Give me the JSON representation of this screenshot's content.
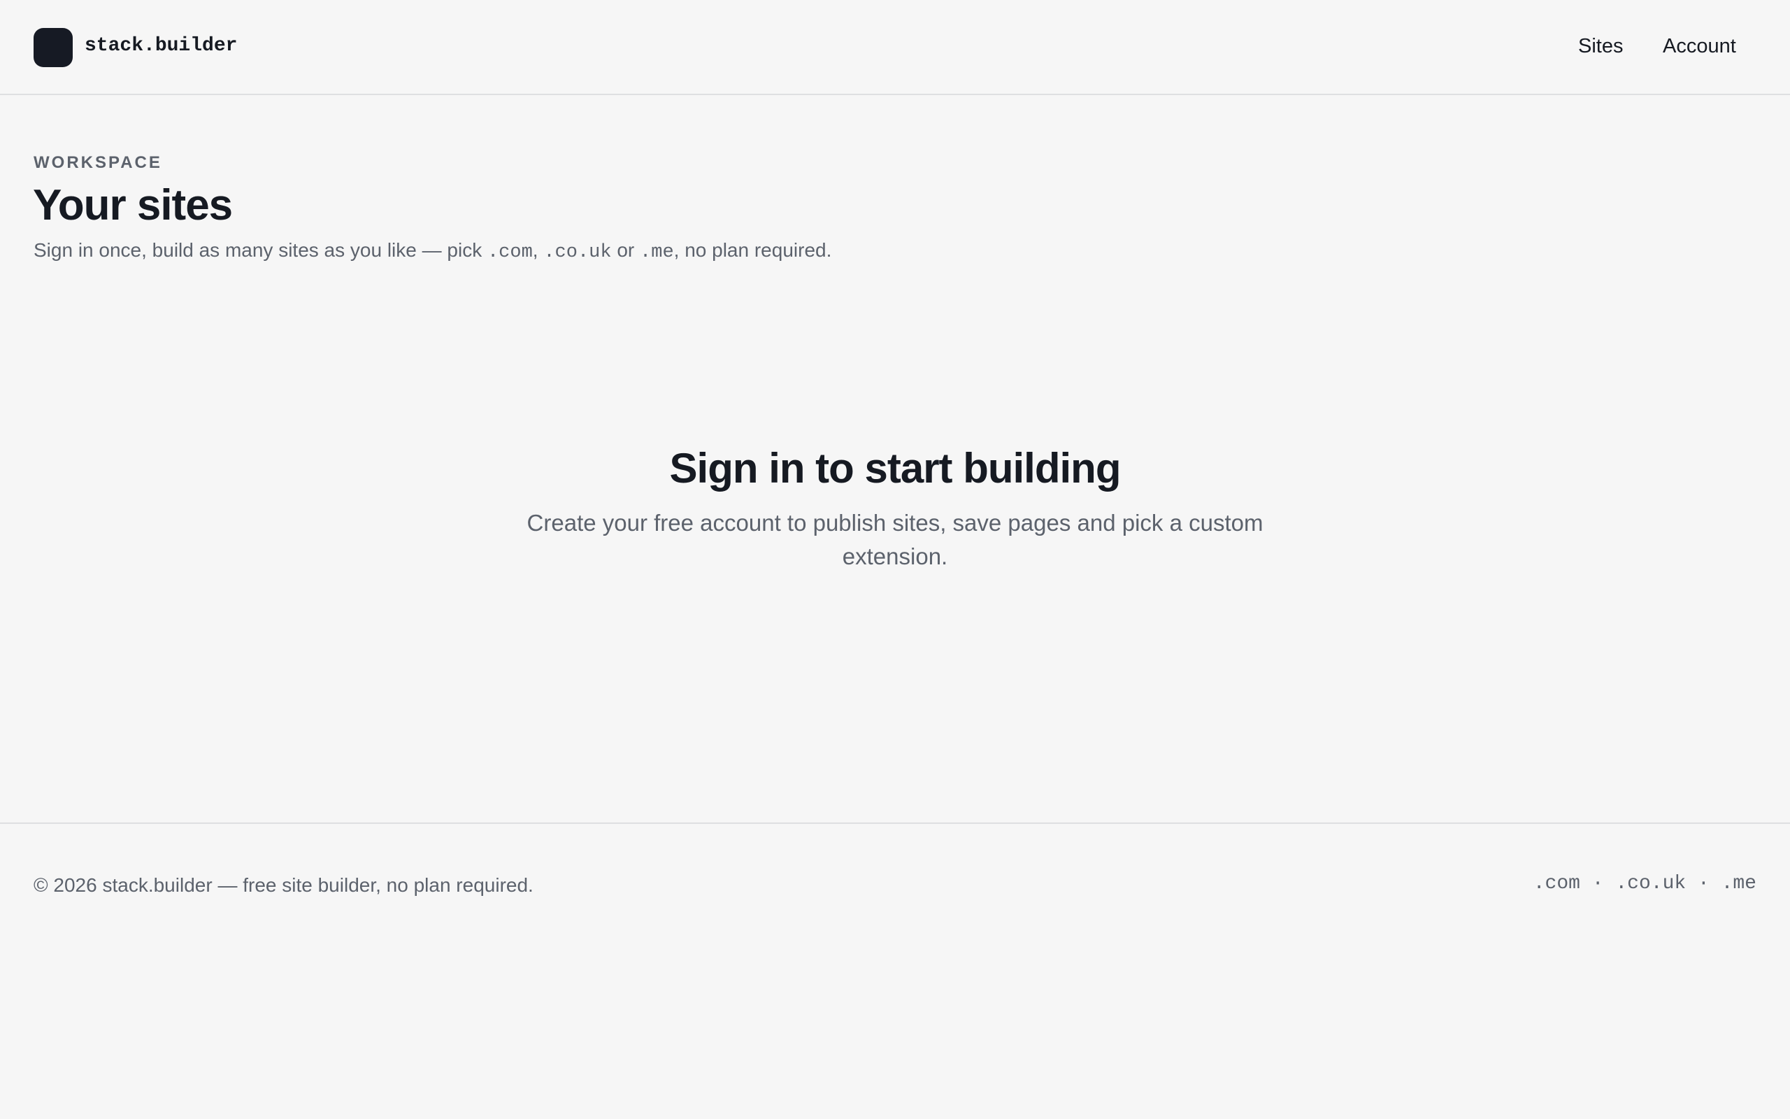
{
  "header": {
    "brand": "stack.builder",
    "nav": {
      "sites": "Sites",
      "account": "Account"
    }
  },
  "main": {
    "eyebrow": "WORKSPACE",
    "title": "Your sites",
    "subtitle": {
      "part1": "Sign in once, build as many sites as you like — pick ",
      "ext1": ".com",
      "sep1": ", ",
      "ext2": ".co.uk",
      "sep2": " or ",
      "ext3": ".me",
      "part2": ", no plan required."
    },
    "empty_state": {
      "title": "Sign in to start building",
      "text": "Create your free account to publish sites, save pages and pick a custom extension."
    }
  },
  "footer": {
    "copyright": "© 2026 stack.builder — free site builder, no plan required.",
    "extensions": ".com · .co.uk · .me"
  },
  "colors": {
    "background": "#f6f6f6",
    "text": "#161a22",
    "muted": "#5c626c",
    "border": "#dedfe1",
    "logo": "#161a24"
  }
}
